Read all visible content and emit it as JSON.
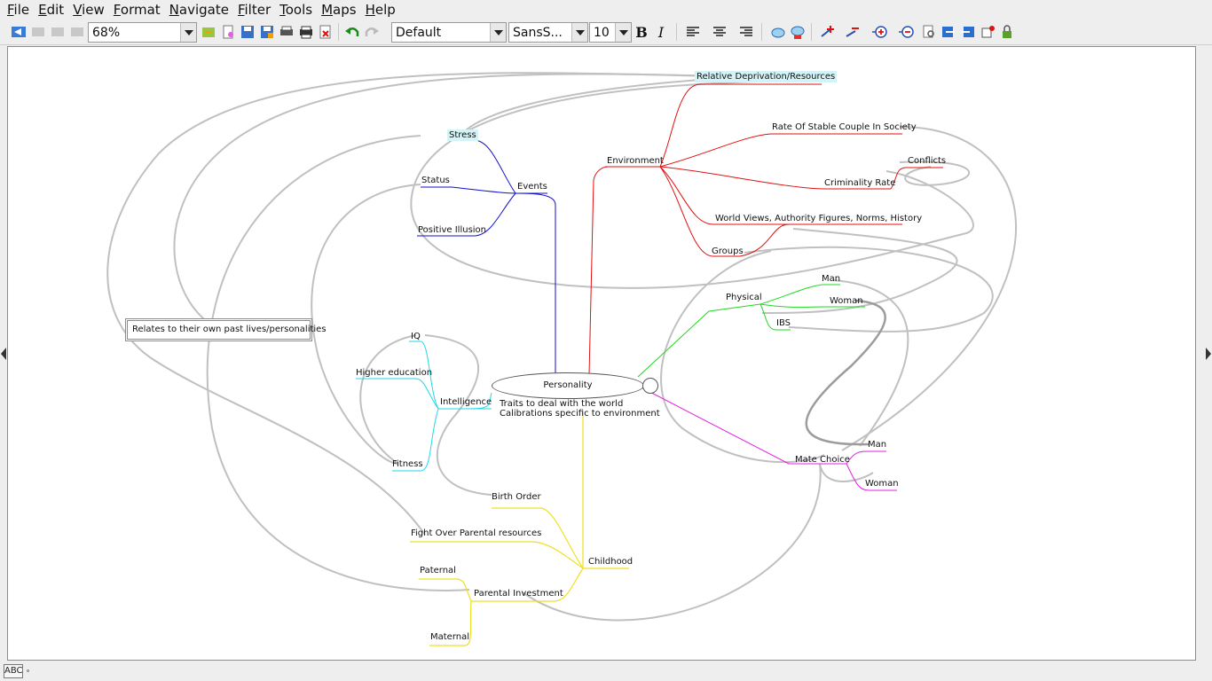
{
  "menubar": {
    "items": [
      {
        "mnemonic": "F",
        "rest": "ile"
      },
      {
        "mnemonic": "E",
        "rest": "dit"
      },
      {
        "mnemonic": "V",
        "rest": "iew"
      },
      {
        "mnemonic": "F",
        "rest": "ormat"
      },
      {
        "mnemonic": "N",
        "rest": "avigate"
      },
      {
        "mnemonic": "F",
        "rest": "ilter"
      },
      {
        "mnemonic": "T",
        "rest": "ools"
      },
      {
        "mnemonic": "M",
        "rest": "aps"
      },
      {
        "mnemonic": "H",
        "rest": "elp"
      }
    ]
  },
  "toolbar": {
    "zoom": "68%",
    "style": "Default",
    "font": "SansS...",
    "size": "10",
    "bold": "B",
    "italic": "I"
  },
  "map": {
    "root": "Personality",
    "root_note_line1": "Traits to deal with the world",
    "root_note_line2": "Calibrations specific to environment",
    "free_note": "Relates to their own past lives/personalities",
    "events": {
      "label": "Events",
      "children": [
        "Stress",
        "Status",
        "Positive Illusion"
      ]
    },
    "environment": {
      "label": "Environment",
      "children": [
        "Relative Deprivation/Resources",
        "Rate Of Stable Couple In Society",
        "Criminality Rate",
        "Conflicts",
        "World Views, Authority Figures, Norms, History",
        "Groups"
      ]
    },
    "physical": {
      "label": "Physical",
      "children": [
        "Man",
        "Woman",
        "IBS"
      ]
    },
    "mate_choice": {
      "label": "Mate Choice",
      "children": [
        "Man",
        "Woman"
      ]
    },
    "intelligence": {
      "label": "Intelligence",
      "children": [
        "IQ",
        "Higher education",
        "Fitness"
      ]
    },
    "childhood": {
      "label": "Childhood",
      "children": [
        "Birth Order",
        "Fight Over Parental resources",
        "Parental Investment",
        "Paternal",
        "Maternal"
      ]
    },
    "colors": {
      "events": "#1010c8",
      "environment": "#e01010",
      "physical": "#20d820",
      "mate_choice": "#e020e0",
      "intelligence": "#20d8e8",
      "childhood": "#f0e020",
      "links": "#c0c0c0",
      "highlight": "#d4f3f7"
    }
  },
  "statusbar": {
    "spell": "ABC"
  }
}
